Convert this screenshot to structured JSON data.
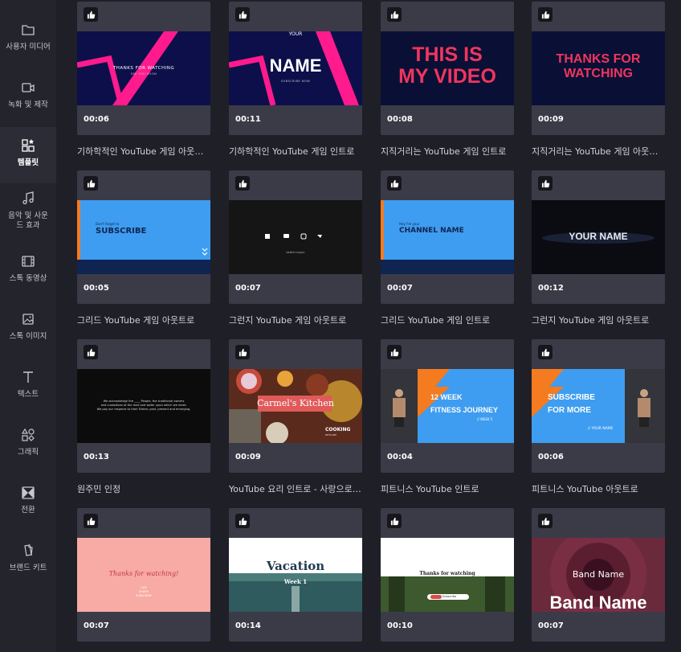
{
  "sidebar": {
    "items": [
      {
        "label": "사용자 미디어",
        "icon": "folder-icon"
      },
      {
        "label": "녹화 및 제작",
        "icon": "video-camera-icon"
      },
      {
        "label": "템플릿",
        "icon": "templates-icon"
      },
      {
        "label": "음악 및 사운드 효과",
        "icon": "music-note-icon"
      },
      {
        "label": "스톡 동영상",
        "icon": "film-icon"
      },
      {
        "label": "스톡 이미지",
        "icon": "image-icon"
      },
      {
        "label": "텍스트",
        "icon": "text-icon"
      },
      {
        "label": "그래픽",
        "icon": "shapes-icon"
      },
      {
        "label": "전환",
        "icon": "transition-icon"
      },
      {
        "label": "브랜드 키트",
        "icon": "brand-kit-icon"
      }
    ],
    "active_index": 2
  },
  "templates": [
    {
      "duration": "00:06",
      "title": "기하학적인 YouTube 게임 아웃트로",
      "thumb": {
        "line1": "THANKS FOR WATCHING",
        "line2": "SEE YOU SOON"
      }
    },
    {
      "duration": "00:11",
      "title": "기하학적인 YouTube 게임 인트로",
      "thumb": {
        "line1": "YOUR",
        "line2": "NAME",
        "line3": "SUBSCRIBE NOW"
      }
    },
    {
      "duration": "00:08",
      "title": "지직거리는 YouTube 게임 인트로",
      "thumb": {
        "line1": "THIS IS",
        "line2": "MY VIDEO"
      }
    },
    {
      "duration": "00:09",
      "title": "지직거리는 YouTube 게임 아웃트로",
      "thumb": {
        "line1": "THANKS FOR",
        "line2": "WATCHING"
      }
    },
    {
      "duration": "00:05",
      "title": "그리드 YouTube 게임 아웃트로",
      "thumb": {
        "line1": "Don't forget to",
        "line2": "SUBSCRIBE"
      }
    },
    {
      "duration": "00:07",
      "title": "그런지 YouTube 게임 아웃트로",
      "thumb": {
        "line1": "twitch.tv/you"
      }
    },
    {
      "duration": "00:07",
      "title": "그리드 YouTube 게임 인트로",
      "thumb": {
        "line1": "Hey I'm your",
        "line2": "CHANNEL NAME"
      }
    },
    {
      "duration": "00:12",
      "title": "그런지 YouTube 게임 아웃트로",
      "thumb": {
        "line1": "YOUR NAME"
      }
    },
    {
      "duration": "00:13",
      "title": "원주민 인정",
      "thumb": {
        "line1": "We acknowledge the ____ People, the traditional owners",
        "line2": "and custodians of the land and water upon which we meet.",
        "line3": "We pay our respects to their Elders; past, present and emerging."
      }
    },
    {
      "duration": "00:09",
      "title": "YouTube 요리 인트로 - 사랑으로 만드는 요리",
      "thumb": {
        "line1": "Carmel's Kitchen",
        "line2": "COOKING",
        "line3": "WITH LOVE"
      }
    },
    {
      "duration": "00:04",
      "title": "피트니스 YouTube 인트로",
      "thumb": {
        "line1": "12 WEEK",
        "line2": "FITNESS JOURNEY",
        "line3": "// WEEK 5"
      }
    },
    {
      "duration": "00:06",
      "title": "피트니스 YouTube 아웃트로",
      "thumb": {
        "line1": "SUBSCRIBE",
        "line2": "FOR MORE",
        "line3": "// YOUR NAME"
      }
    },
    {
      "duration": "00:07",
      "title": "",
      "thumb": {
        "line1": "Thanks for watching!",
        "line2": "LIKE",
        "line3": "SHARE",
        "line4": "SUBSCRIBE"
      }
    },
    {
      "duration": "00:14",
      "title": "",
      "thumb": {
        "line1": "Vacation",
        "line2": "Week 1"
      }
    },
    {
      "duration": "00:10",
      "title": "",
      "thumb": {
        "line1": "Thanks for watching",
        "line2": "Subscribe"
      }
    },
    {
      "duration": "00:07",
      "title": "",
      "thumb": {
        "line1": "Band Name",
        "line2": "Band Name"
      }
    }
  ],
  "colors": {
    "pink": "#ff1b8d",
    "navy": "#0d0f4a",
    "blue": "#3e9df0",
    "orange": "#f47b20",
    "salmon": "#f8aaa5"
  }
}
